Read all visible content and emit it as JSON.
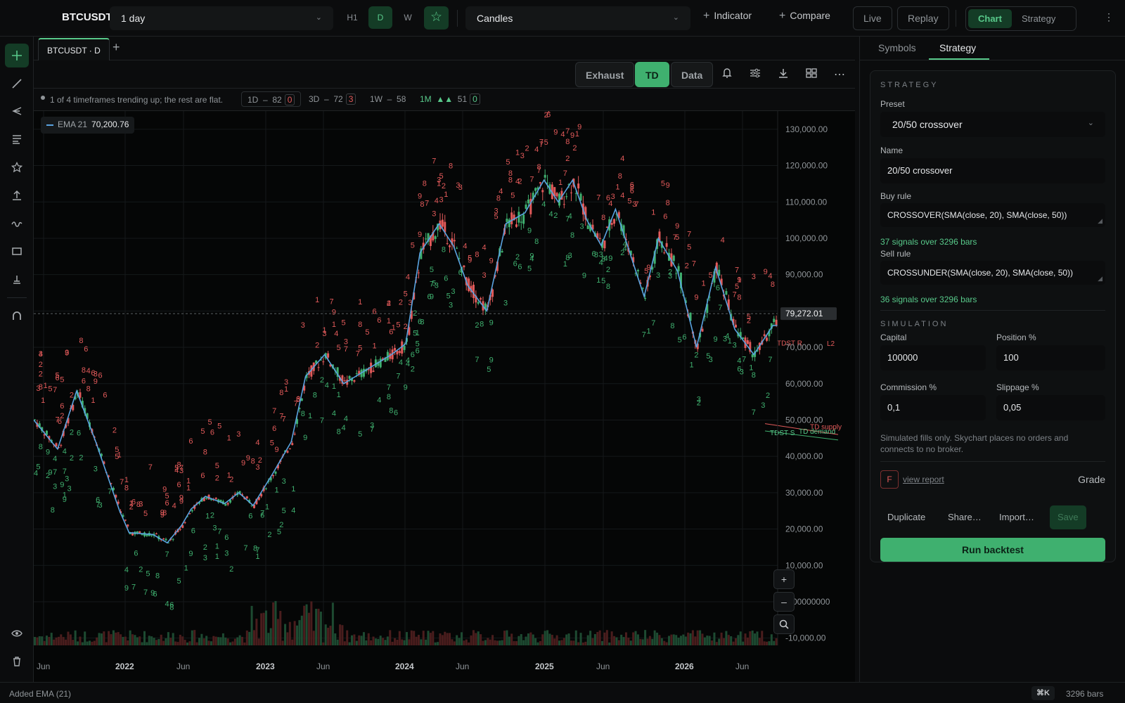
{
  "colors": {
    "accent": "#58c98a",
    "accent_strong": "#3fb06f",
    "down": "#e25a5a",
    "ema": "#5aa3e0",
    "background": "#0b0c0d"
  },
  "topbar": {
    "symbol": "BTCUSDT",
    "timeframe": "1 day",
    "tf_buttons": [
      "H1",
      "D",
      "W"
    ],
    "favorite_icon": "star-icon",
    "chart_type": "Candles",
    "indicator_label": "Indicator",
    "compare_label": "Compare",
    "live_label": "Live",
    "replay_label": "Replay",
    "mode_chart": "Chart",
    "mode_strategy": "Strategy"
  },
  "left_tools": [
    "crosshair-icon",
    "trendline-icon",
    "pitchfork-icon",
    "text-icon",
    "star-icon",
    "arrow-up-icon",
    "wave-icon",
    "rectangle-icon",
    "measure-icon",
    "magnet-icon",
    "eye-icon",
    "trash-icon"
  ],
  "chart_tab": {
    "label": "BTCUSDT · D"
  },
  "toolbar": {
    "exhaust": "Exhaust",
    "td": "TD",
    "data": "Data"
  },
  "trend": {
    "message": "1 of 4 timeframes trending up; the rest are flat.",
    "chips": [
      {
        "tf": "1D",
        "dir": "–",
        "score": "82",
        "count": "0"
      },
      {
        "tf": "3D",
        "dir": "–",
        "score": "72",
        "count": "3"
      },
      {
        "tf": "1W",
        "dir": "–",
        "score": "58"
      },
      {
        "tf": "1M",
        "dir": "▲▲",
        "score": "51",
        "count": "0"
      }
    ]
  },
  "legend": {
    "name": "EMA 21",
    "value": "70,200.76"
  },
  "chart_data": {
    "type": "candlestick",
    "symbol": "BTCUSDT",
    "interval": "1D",
    "ylim": [
      -10000,
      135000
    ],
    "y_ticks": [
      "130,000.00",
      "120,000.00",
      "110,000.00",
      "100,000.00",
      "90,000.00",
      "80,000.00",
      "70,000.00",
      "60,000.00",
      "50,000.00",
      "40,000.00",
      "30,000.00",
      "20,000.00",
      "10,000.00",
      "0.00000000",
      "-10,000.00"
    ],
    "x_ticks": [
      "Jun",
      "2022",
      "Jun",
      "2023",
      "Jun",
      "2024",
      "Jun",
      "2025",
      "Jun",
      "2026",
      "Jun"
    ],
    "last_price": "79,272.01",
    "ema_last": 70200.76,
    "series": [
      {
        "name": "EMA 21",
        "points": [
          [
            0,
            50000
          ],
          [
            10,
            42000
          ],
          [
            18,
            58000
          ],
          [
            26,
            44000
          ],
          [
            36,
            25000
          ],
          [
            40,
            19000
          ],
          [
            50,
            18500
          ],
          [
            56,
            16200
          ],
          [
            62,
            21000
          ],
          [
            66,
            25500
          ],
          [
            72,
            29000
          ],
          [
            80,
            27000
          ],
          [
            86,
            30000
          ],
          [
            92,
            26500
          ],
          [
            100,
            35000
          ],
          [
            108,
            44000
          ],
          [
            114,
            62000
          ],
          [
            122,
            68000
          ],
          [
            130,
            60000
          ],
          [
            140,
            64000
          ],
          [
            150,
            68000
          ],
          [
            156,
            71000
          ],
          [
            162,
            96000
          ],
          [
            170,
            104000
          ],
          [
            176,
            98000
          ],
          [
            182,
            87000
          ],
          [
            190,
            80000
          ],
          [
            198,
            104000
          ],
          [
            206,
            107000
          ],
          [
            214,
            116000
          ],
          [
            220,
            110000
          ],
          [
            226,
            116000
          ],
          [
            232,
            105000
          ],
          [
            238,
            98000
          ],
          [
            244,
            108000
          ],
          [
            250,
            96000
          ],
          [
            256,
            84000
          ],
          [
            262,
            100000
          ],
          [
            270,
            91000
          ],
          [
            278,
            70000
          ],
          [
            286,
            92000
          ],
          [
            294,
            75000
          ],
          [
            302,
            68000
          ],
          [
            310,
            76000
          ]
        ]
      }
    ],
    "overlays": [
      "TDST R",
      "TDST S",
      "TD demand",
      "TD supply",
      "L2"
    ]
  },
  "sidebar": {
    "tab_symbols": "Symbols",
    "tab_strategy": "Strategy",
    "strategy_title": "STRATEGY",
    "preset_label": "Preset",
    "preset_value": "20/50 crossover",
    "name_label": "Name",
    "name_value": "20/50 crossover",
    "buy_label": "Buy rule",
    "buy_value": "CROSSOVER(SMA(close, 20), SMA(close, 50))",
    "buy_hint": "37 signals over 3296 bars",
    "sell_label": "Sell rule",
    "sell_value": "CROSSUNDER(SMA(close, 20), SMA(close, 50))",
    "sell_hint": "36 signals over 3296 bars",
    "sim_title": "SIMULATION",
    "capital_label": "Capital",
    "capital_value": "100000",
    "position_label": "Position %",
    "position_value": "100",
    "commission_label": "Commission %",
    "commission_value": "0,1",
    "slippage_label": "Slippage %",
    "slippage_value": "0,05",
    "note": "Simulated fills only. Skychart places no orders and connects to no broker.",
    "grade_letter": "F",
    "view_report": "view report",
    "grade_label": "Grade",
    "duplicate": "Duplicate",
    "share": "Share…",
    "import": "Import…",
    "save": "Save",
    "run": "Run backtest"
  },
  "status": {
    "message": "Added EMA (21)",
    "shortcut": "⌘K",
    "bars": "3296 bars"
  }
}
